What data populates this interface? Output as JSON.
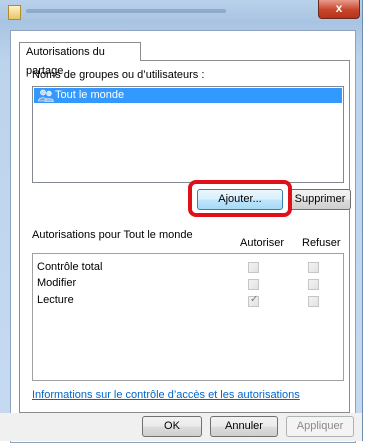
{
  "window": {
    "close_glyph": "x"
  },
  "tab": {
    "label": "Autorisations du partage"
  },
  "groups": {
    "label": "Noms de groupes ou d’utilisateurs :",
    "items": [
      {
        "label": "Tout le monde",
        "icon": "users-icon",
        "selected": true
      }
    ]
  },
  "buttons": {
    "add": "Ajouter...",
    "remove": "Supprimer",
    "ok": "OK",
    "cancel": "Annuler",
    "apply": "Appliquer"
  },
  "permissions": {
    "label": "Autorisations pour Tout le monde",
    "col_allow": "Autoriser",
    "col_deny": "Refuser",
    "rows": [
      {
        "label": "Contrôle total",
        "allow": false,
        "deny": false
      },
      {
        "label": "Modifier",
        "allow": false,
        "deny": false
      },
      {
        "label": "Lecture",
        "allow": true,
        "deny": false
      }
    ]
  },
  "link": {
    "text": "Informations sur le contrôle d’accès et les autorisations"
  },
  "colors": {
    "selection": "#3399ff",
    "highlight_ring": "#e0101a",
    "link": "#0066cc"
  }
}
